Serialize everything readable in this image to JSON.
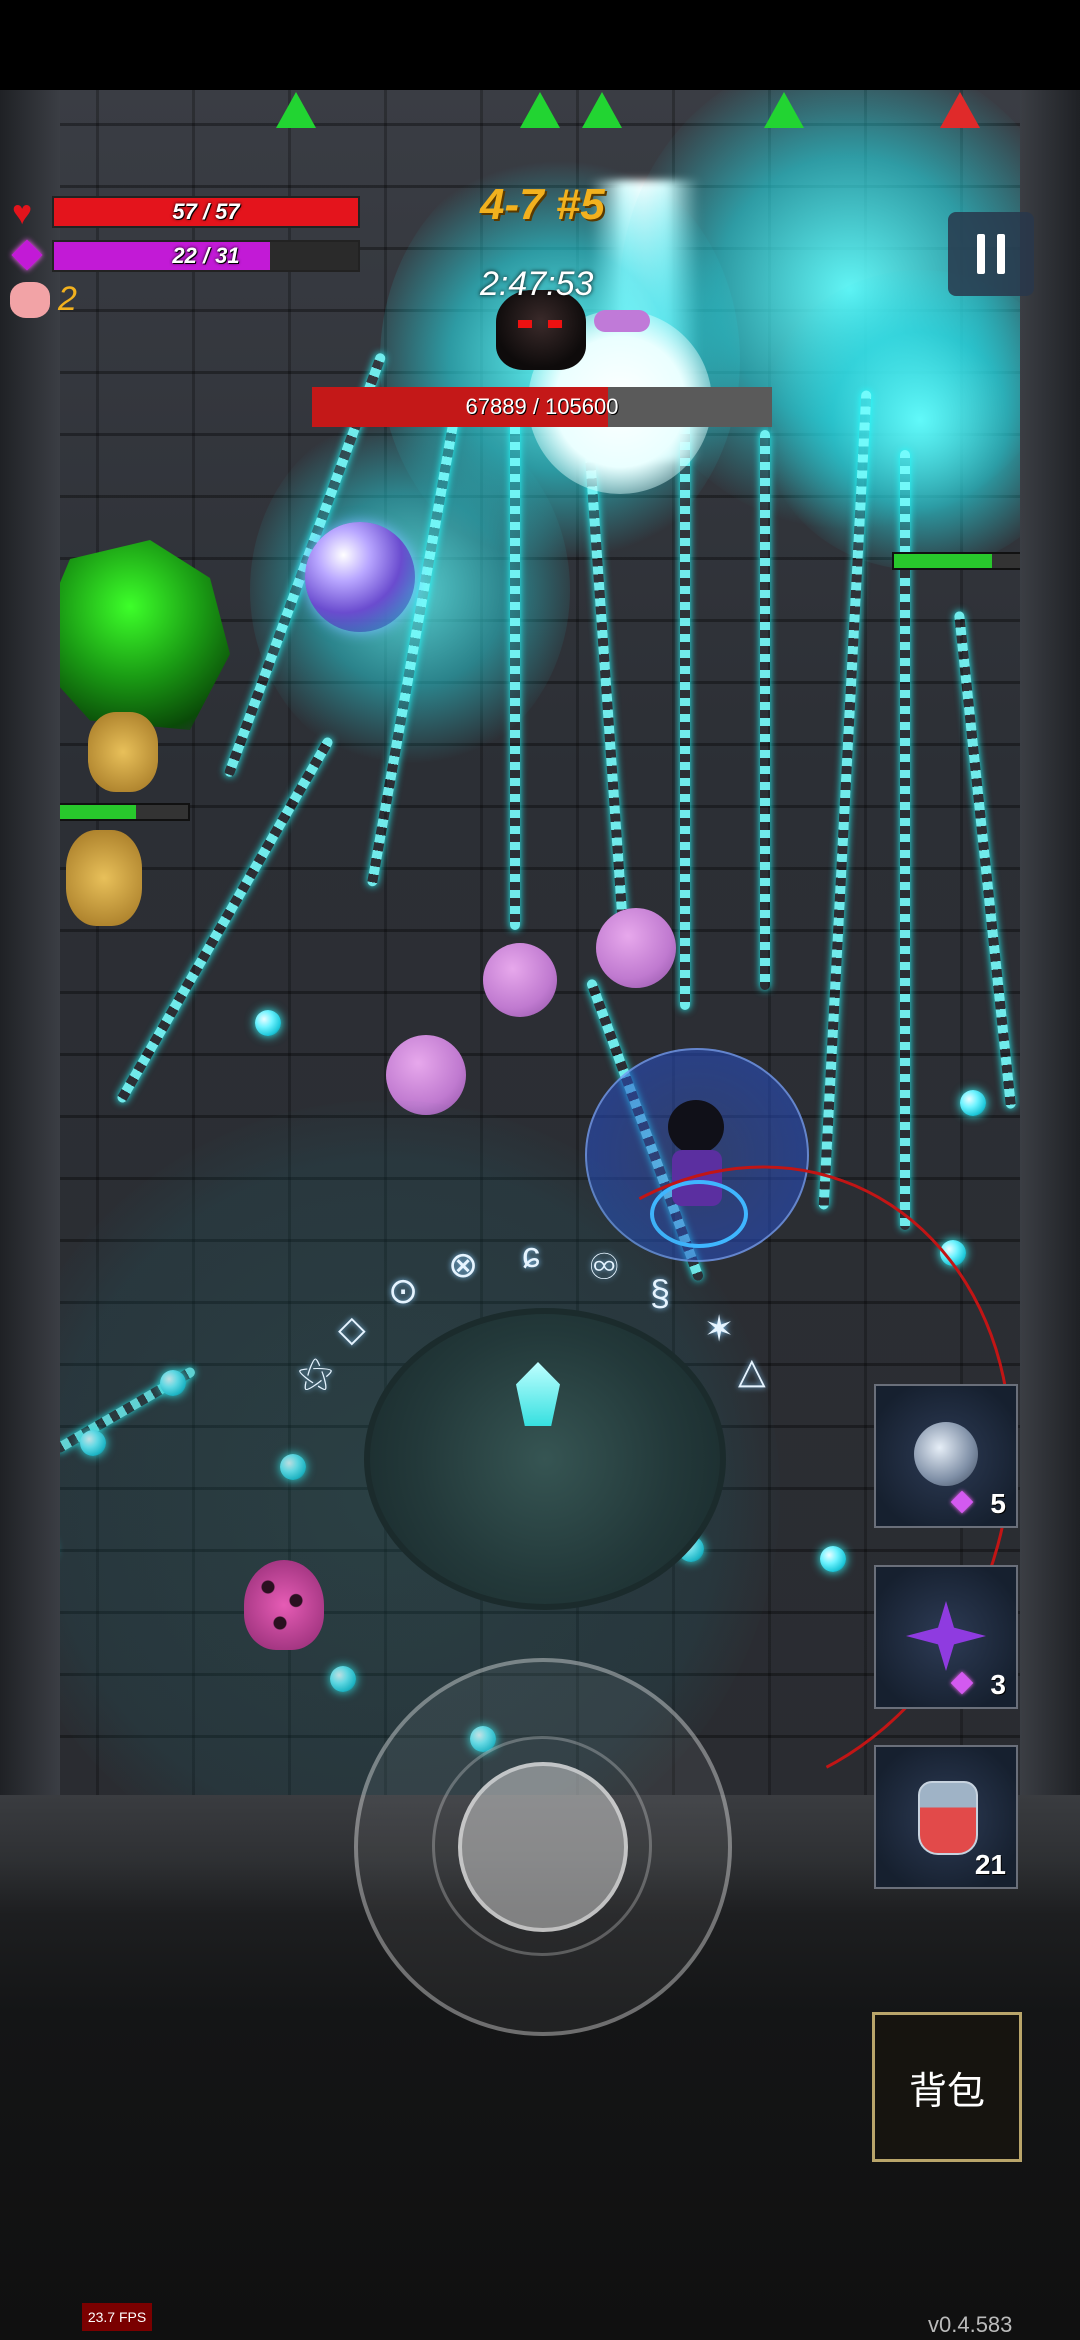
{
  "hud": {
    "hp": {
      "current": 57,
      "max": 57,
      "text": "57 / 57",
      "color": "#e4141c"
    },
    "mana": {
      "current": 22,
      "max": 31,
      "text": "22 / 31",
      "color": "#c21ad6"
    },
    "pig_count": "2",
    "stage": "4-7 #5",
    "timer": "2:47:53"
  },
  "boss": {
    "hp_text": "67889 / 105600",
    "hp_fraction": 0.643
  },
  "skills": [
    {
      "name": "armor-orb",
      "cost": "5"
    },
    {
      "name": "purple-shuriken",
      "cost": "3"
    },
    {
      "name": "health-potion",
      "count": "21"
    }
  ],
  "bag_label": "背包",
  "fps_text": "23.7 FPS",
  "version_text": "v0.4.583",
  "colors": {
    "accent_gold": "#f2b11e",
    "cyan_fx": "#4ff2ff",
    "enemy_hp": "#28c82c"
  },
  "runes": [
    "⊗",
    "ɕ",
    "♾",
    "§",
    "⊙",
    "◇",
    "⚝",
    "△",
    "✶",
    "⋈"
  ]
}
